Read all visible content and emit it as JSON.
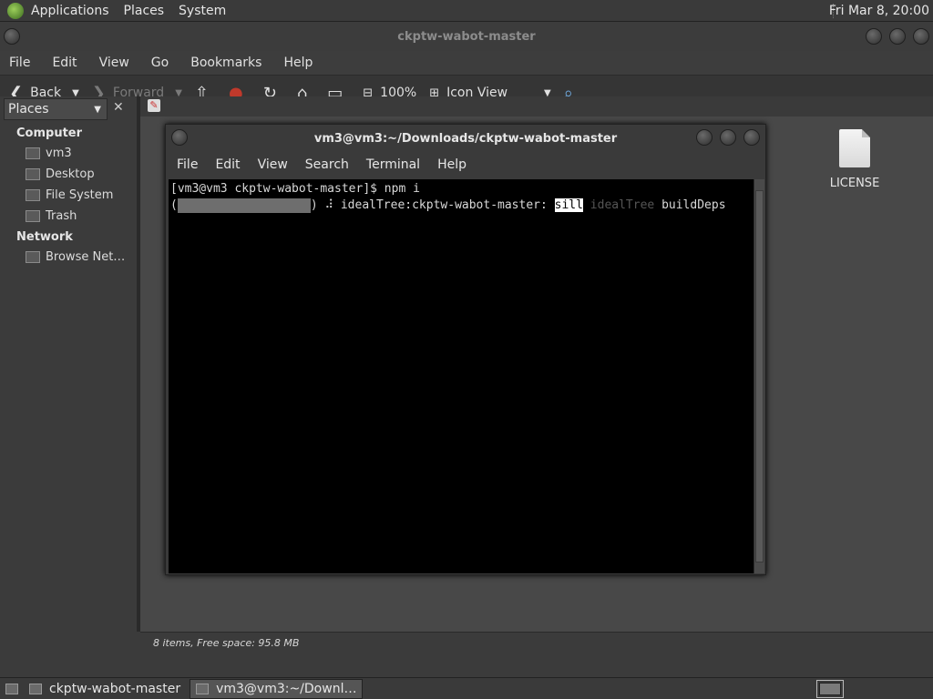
{
  "top_panel": {
    "applications": "Applications",
    "places": "Places",
    "system": "System",
    "clock": "Fri Mar  8, 20:00"
  },
  "file_manager": {
    "title": "ckptw-wabot-master",
    "menu": [
      "File",
      "Edit",
      "View",
      "Go",
      "Bookmarks",
      "Help"
    ],
    "toolbar": {
      "back": "Back",
      "forward": "Forward",
      "zoom": "100%",
      "view_mode": "Icon View"
    },
    "sidebar": {
      "header": "Places",
      "computer_title": "Computer",
      "computer_items": [
        "vm3",
        "Desktop",
        "File System",
        "Trash"
      ],
      "network_title": "Network",
      "network_items": [
        "Browse Net…"
      ]
    },
    "files": [
      {
        "name": "LICENSE",
        "icon": "document-icon"
      }
    ],
    "status": "8 items, Free space: 95.8 MB"
  },
  "terminal": {
    "title": "vm3@vm3:~/Downloads/ckptw-wabot-master",
    "menu": [
      "File",
      "Edit",
      "View",
      "Search",
      "Terminal",
      "Help"
    ],
    "line1": "[vm3@vm3 ckptw-wabot-master]$ npm i",
    "line2": {
      "open_paren": "(",
      "close_paren": ")",
      "spinner": "⠼",
      "prefix": "idealTree:ckptw-wabot-master:",
      "level": "sill",
      "stage": "idealTree",
      "msg": "buildDeps"
    }
  },
  "taskbar": {
    "tasks": [
      "ckptw-wabot-master",
      "vm3@vm3:~/Downl…"
    ]
  }
}
